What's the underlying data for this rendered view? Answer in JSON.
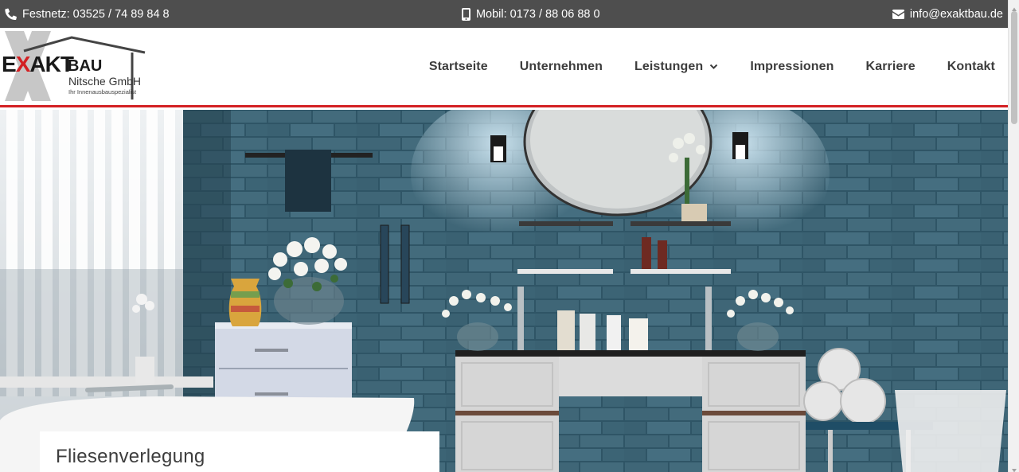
{
  "topbar": {
    "phone_label": "Festnetz: 03525 / 74 89 84 8",
    "mobile_label": "Mobil: 0173 / 88 06 88 0",
    "email_label": "info@exaktbau.de",
    "background": "#4e4e4e"
  },
  "logo": {
    "brand_exakt": "EXAKT",
    "brand_bau": "BAU",
    "company": "Nitsche GmbH",
    "tagline": "Ihr Innenausbauspezialist"
  },
  "nav": {
    "items": [
      {
        "label": "Startseite"
      },
      {
        "label": "Unternehmen"
      },
      {
        "label": "Leistungen",
        "has_dropdown": true
      },
      {
        "label": "Impressionen"
      },
      {
        "label": "Karriere"
      },
      {
        "label": "Kontakt"
      }
    ]
  },
  "hero": {
    "caption": "Fliesenverlegung"
  },
  "colors": {
    "accent_red": "#d32023",
    "nav_text": "#3d3d3d",
    "tile_blue": "#3f6677"
  },
  "icons": [
    "phone-icon",
    "mobile-icon",
    "envelope-icon",
    "chevron-down-icon"
  ]
}
